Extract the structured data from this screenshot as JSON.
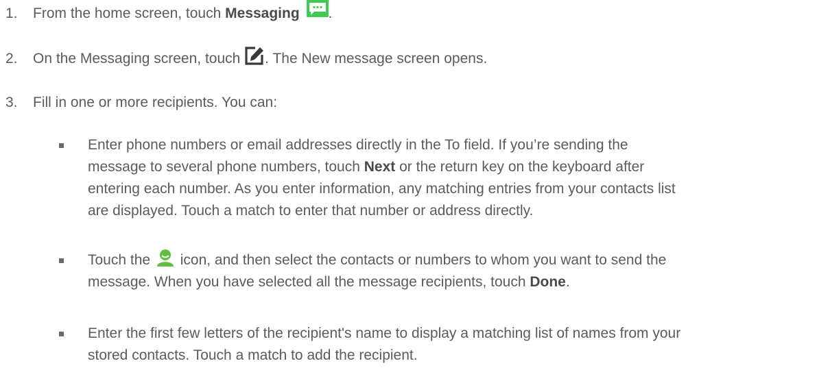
{
  "steps": [
    {
      "number": "1.",
      "before": "From the home screen, touch ",
      "bold": "Messaging",
      "icon": "messaging-app-icon",
      "after": "."
    },
    {
      "number": "2.",
      "before": "On the Messaging screen, touch ",
      "icon": "compose-edit-icon",
      "after": ". The New message screen opens."
    },
    {
      "number": "3.",
      "text": "Fill in one or more recipients. You can:"
    }
  ],
  "bullets": [
    {
      "line1": "Enter phone numbers or email addresses directly in the To field. If you’re sending the",
      "line2_before": "message to several phone numbers, touch ",
      "line2_bold": "Next",
      "line2_after": " or the return key on the keyboard after",
      "line3": "entering each number. As you enter information, any matching entries from your contacts list",
      "line4": "are displayed. Touch a match to enter that number or address directly."
    },
    {
      "line1_before": "Touch the ",
      "icon": "contact-person-icon",
      "line1_after": " icon, and then select the contacts or numbers to whom you want to send the",
      "line2_before": "message. When you have selected all the message recipients, touch ",
      "line2_bold": "Done",
      "line2_after": "."
    },
    {
      "line1": "Enter the first few letters of the recipient's name to display a matching list of names from your",
      "line2": "stored contacts. Touch a match to add the recipient."
    }
  ],
  "colors": {
    "text": "#5b5b5b",
    "messaging_icon": "#3fcb52",
    "contact_icon": "#5fbf3d",
    "compose_icon": "#3a3a3a"
  }
}
